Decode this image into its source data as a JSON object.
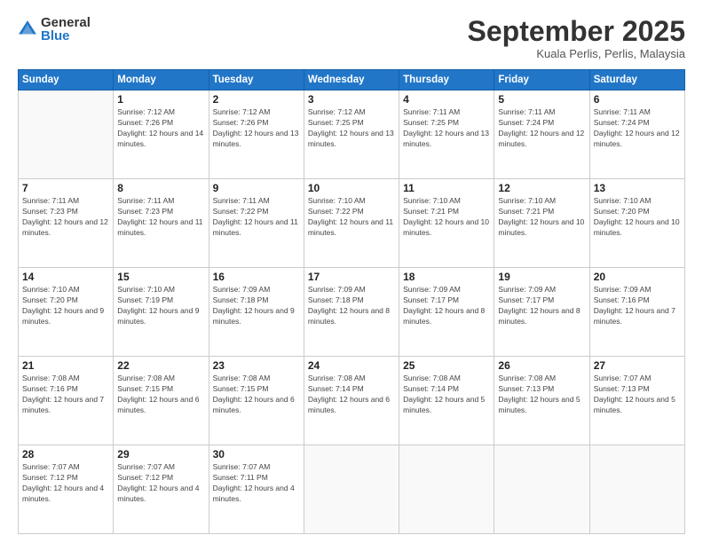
{
  "logo": {
    "general": "General",
    "blue": "Blue"
  },
  "header": {
    "month": "September 2025",
    "location": "Kuala Perlis, Perlis, Malaysia"
  },
  "weekdays": [
    "Sunday",
    "Monday",
    "Tuesday",
    "Wednesday",
    "Thursday",
    "Friday",
    "Saturday"
  ],
  "weeks": [
    [
      {
        "day": "",
        "sunrise": "",
        "sunset": "",
        "daylight": ""
      },
      {
        "day": "1",
        "sunrise": "Sunrise: 7:12 AM",
        "sunset": "Sunset: 7:26 PM",
        "daylight": "Daylight: 12 hours and 14 minutes."
      },
      {
        "day": "2",
        "sunrise": "Sunrise: 7:12 AM",
        "sunset": "Sunset: 7:26 PM",
        "daylight": "Daylight: 12 hours and 13 minutes."
      },
      {
        "day": "3",
        "sunrise": "Sunrise: 7:12 AM",
        "sunset": "Sunset: 7:25 PM",
        "daylight": "Daylight: 12 hours and 13 minutes."
      },
      {
        "day": "4",
        "sunrise": "Sunrise: 7:11 AM",
        "sunset": "Sunset: 7:25 PM",
        "daylight": "Daylight: 12 hours and 13 minutes."
      },
      {
        "day": "5",
        "sunrise": "Sunrise: 7:11 AM",
        "sunset": "Sunset: 7:24 PM",
        "daylight": "Daylight: 12 hours and 12 minutes."
      },
      {
        "day": "6",
        "sunrise": "Sunrise: 7:11 AM",
        "sunset": "Sunset: 7:24 PM",
        "daylight": "Daylight: 12 hours and 12 minutes."
      }
    ],
    [
      {
        "day": "7",
        "sunrise": "Sunrise: 7:11 AM",
        "sunset": "Sunset: 7:23 PM",
        "daylight": "Daylight: 12 hours and 12 minutes."
      },
      {
        "day": "8",
        "sunrise": "Sunrise: 7:11 AM",
        "sunset": "Sunset: 7:23 PM",
        "daylight": "Daylight: 12 hours and 11 minutes."
      },
      {
        "day": "9",
        "sunrise": "Sunrise: 7:11 AM",
        "sunset": "Sunset: 7:22 PM",
        "daylight": "Daylight: 12 hours and 11 minutes."
      },
      {
        "day": "10",
        "sunrise": "Sunrise: 7:10 AM",
        "sunset": "Sunset: 7:22 PM",
        "daylight": "Daylight: 12 hours and 11 minutes."
      },
      {
        "day": "11",
        "sunrise": "Sunrise: 7:10 AM",
        "sunset": "Sunset: 7:21 PM",
        "daylight": "Daylight: 12 hours and 10 minutes."
      },
      {
        "day": "12",
        "sunrise": "Sunrise: 7:10 AM",
        "sunset": "Sunset: 7:21 PM",
        "daylight": "Daylight: 12 hours and 10 minutes."
      },
      {
        "day": "13",
        "sunrise": "Sunrise: 7:10 AM",
        "sunset": "Sunset: 7:20 PM",
        "daylight": "Daylight: 12 hours and 10 minutes."
      }
    ],
    [
      {
        "day": "14",
        "sunrise": "Sunrise: 7:10 AM",
        "sunset": "Sunset: 7:20 PM",
        "daylight": "Daylight: 12 hours and 9 minutes."
      },
      {
        "day": "15",
        "sunrise": "Sunrise: 7:10 AM",
        "sunset": "Sunset: 7:19 PM",
        "daylight": "Daylight: 12 hours and 9 minutes."
      },
      {
        "day": "16",
        "sunrise": "Sunrise: 7:09 AM",
        "sunset": "Sunset: 7:18 PM",
        "daylight": "Daylight: 12 hours and 9 minutes."
      },
      {
        "day": "17",
        "sunrise": "Sunrise: 7:09 AM",
        "sunset": "Sunset: 7:18 PM",
        "daylight": "Daylight: 12 hours and 8 minutes."
      },
      {
        "day": "18",
        "sunrise": "Sunrise: 7:09 AM",
        "sunset": "Sunset: 7:17 PM",
        "daylight": "Daylight: 12 hours and 8 minutes."
      },
      {
        "day": "19",
        "sunrise": "Sunrise: 7:09 AM",
        "sunset": "Sunset: 7:17 PM",
        "daylight": "Daylight: 12 hours and 8 minutes."
      },
      {
        "day": "20",
        "sunrise": "Sunrise: 7:09 AM",
        "sunset": "Sunset: 7:16 PM",
        "daylight": "Daylight: 12 hours and 7 minutes."
      }
    ],
    [
      {
        "day": "21",
        "sunrise": "Sunrise: 7:08 AM",
        "sunset": "Sunset: 7:16 PM",
        "daylight": "Daylight: 12 hours and 7 minutes."
      },
      {
        "day": "22",
        "sunrise": "Sunrise: 7:08 AM",
        "sunset": "Sunset: 7:15 PM",
        "daylight": "Daylight: 12 hours and 6 minutes."
      },
      {
        "day": "23",
        "sunrise": "Sunrise: 7:08 AM",
        "sunset": "Sunset: 7:15 PM",
        "daylight": "Daylight: 12 hours and 6 minutes."
      },
      {
        "day": "24",
        "sunrise": "Sunrise: 7:08 AM",
        "sunset": "Sunset: 7:14 PM",
        "daylight": "Daylight: 12 hours and 6 minutes."
      },
      {
        "day": "25",
        "sunrise": "Sunrise: 7:08 AM",
        "sunset": "Sunset: 7:14 PM",
        "daylight": "Daylight: 12 hours and 5 minutes."
      },
      {
        "day": "26",
        "sunrise": "Sunrise: 7:08 AM",
        "sunset": "Sunset: 7:13 PM",
        "daylight": "Daylight: 12 hours and 5 minutes."
      },
      {
        "day": "27",
        "sunrise": "Sunrise: 7:07 AM",
        "sunset": "Sunset: 7:13 PM",
        "daylight": "Daylight: 12 hours and 5 minutes."
      }
    ],
    [
      {
        "day": "28",
        "sunrise": "Sunrise: 7:07 AM",
        "sunset": "Sunset: 7:12 PM",
        "daylight": "Daylight: 12 hours and 4 minutes."
      },
      {
        "day": "29",
        "sunrise": "Sunrise: 7:07 AM",
        "sunset": "Sunset: 7:12 PM",
        "daylight": "Daylight: 12 hours and 4 minutes."
      },
      {
        "day": "30",
        "sunrise": "Sunrise: 7:07 AM",
        "sunset": "Sunset: 7:11 PM",
        "daylight": "Daylight: 12 hours and 4 minutes."
      },
      {
        "day": "",
        "sunrise": "",
        "sunset": "",
        "daylight": ""
      },
      {
        "day": "",
        "sunrise": "",
        "sunset": "",
        "daylight": ""
      },
      {
        "day": "",
        "sunrise": "",
        "sunset": "",
        "daylight": ""
      },
      {
        "day": "",
        "sunrise": "",
        "sunset": "",
        "daylight": ""
      }
    ]
  ]
}
